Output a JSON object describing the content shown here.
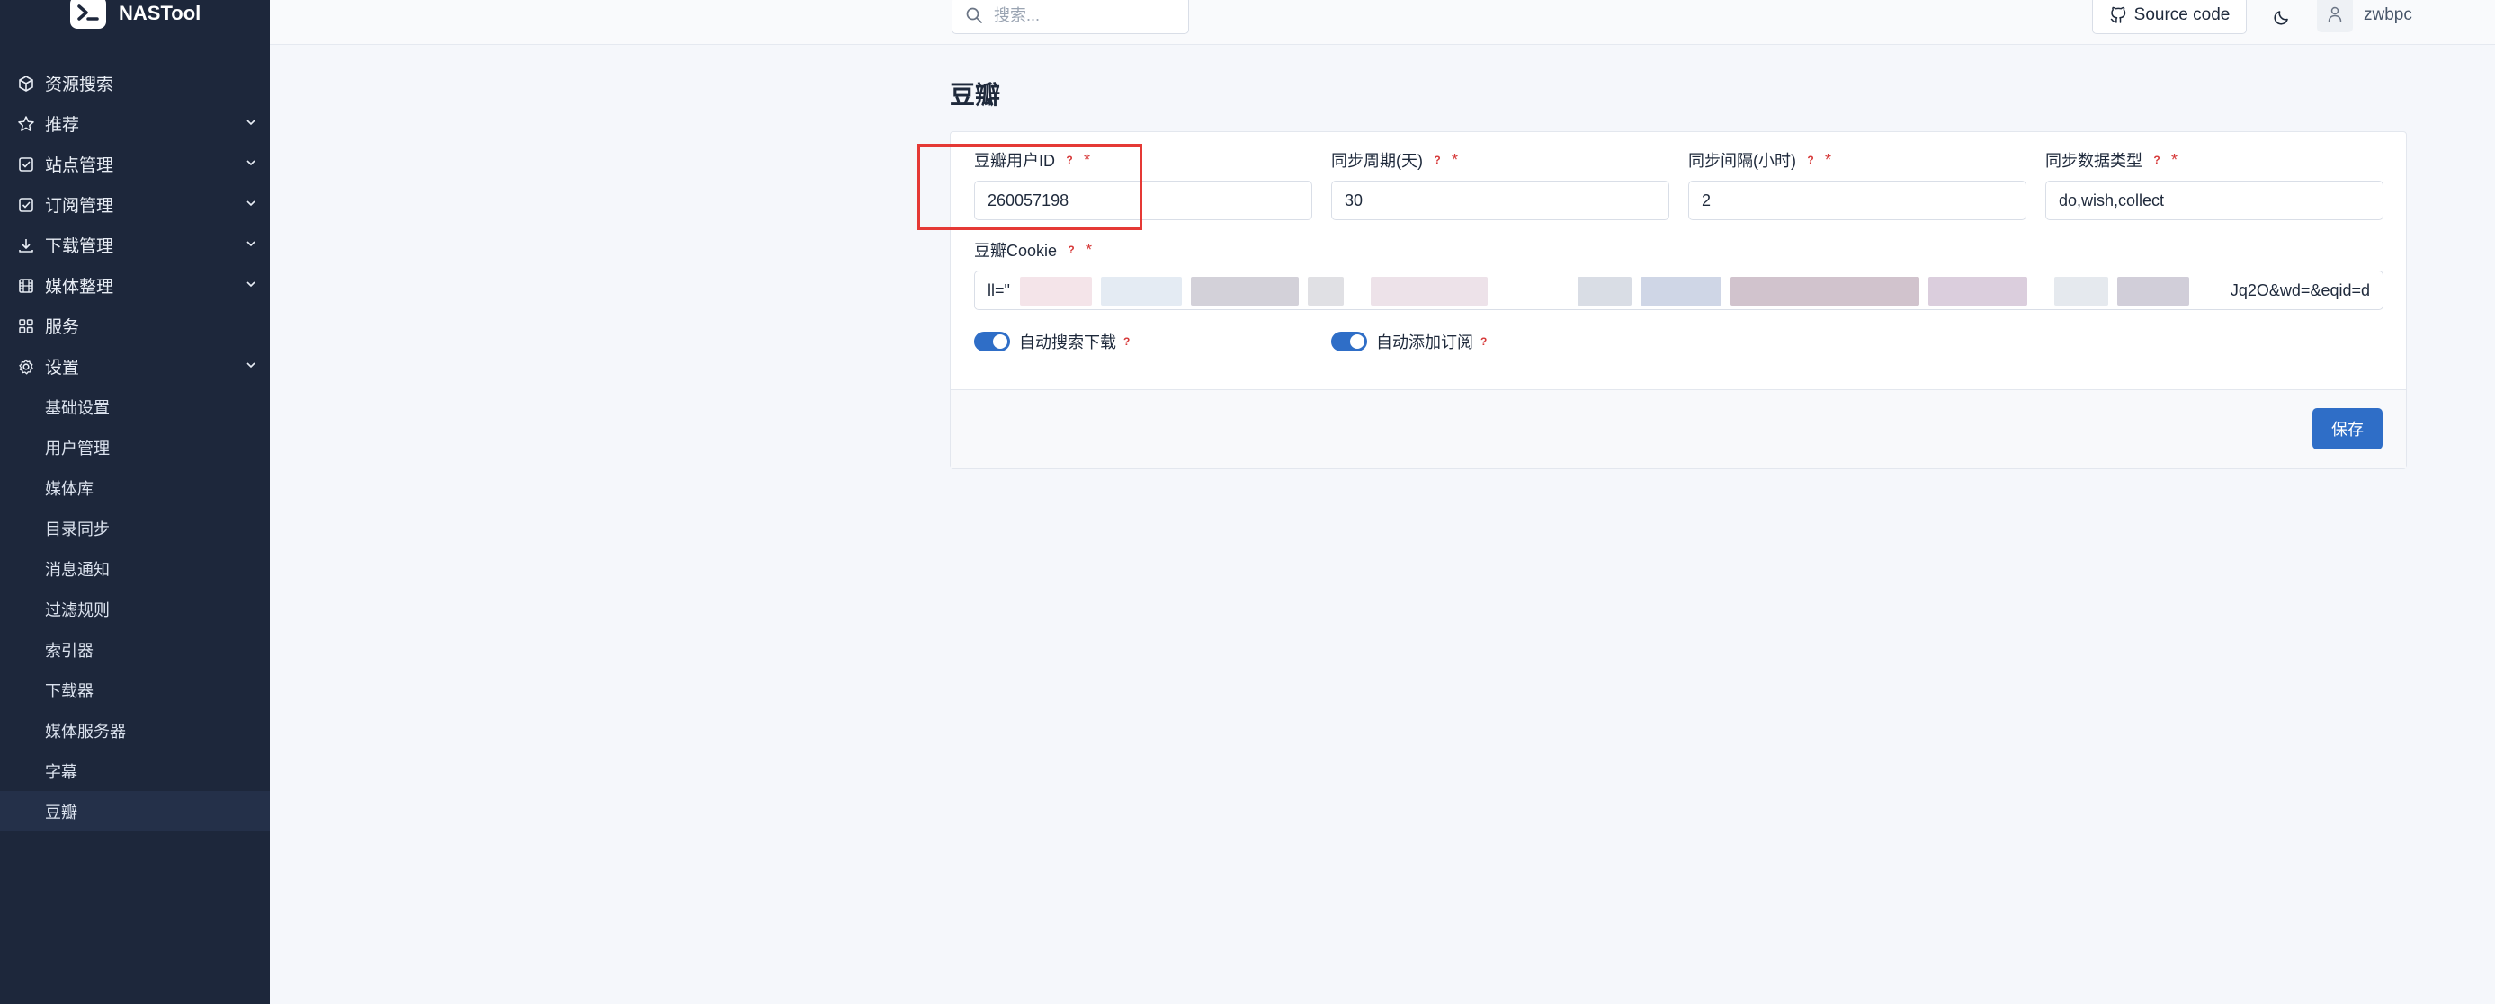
{
  "app": {
    "name": "NASTool"
  },
  "sidebar": {
    "items": [
      {
        "label": "资源搜索",
        "icon": "cube-icon",
        "has_children": false
      },
      {
        "label": "推荐",
        "icon": "star-icon",
        "has_children": true
      },
      {
        "label": "站点管理",
        "icon": "checkbox-icon",
        "has_children": true
      },
      {
        "label": "订阅管理",
        "icon": "checkbox-icon",
        "has_children": true
      },
      {
        "label": "下载管理",
        "icon": "download-icon",
        "has_children": true
      },
      {
        "label": "媒体整理",
        "icon": "film-icon",
        "has_children": true
      },
      {
        "label": "服务",
        "icon": "grid-icon",
        "has_children": false
      },
      {
        "label": "设置",
        "icon": "gear-icon",
        "has_children": true
      }
    ],
    "settings_children": [
      "基础设置",
      "用户管理",
      "媒体库",
      "目录同步",
      "消息通知",
      "过滤规则",
      "索引器",
      "下载器",
      "媒体服务器",
      "字幕",
      "豆瓣"
    ],
    "active_child": "豆瓣"
  },
  "header": {
    "search_placeholder": "搜索...",
    "source_code_label": "Source code",
    "username": "zwbpc"
  },
  "page": {
    "title": "豆瓣",
    "fields": {
      "user_id": {
        "label": "豆瓣用户ID",
        "value": "260057198"
      },
      "sync_period": {
        "label": "同步周期(天)",
        "value": "30"
      },
      "sync_interval": {
        "label": "同步间隔(小时)",
        "value": "2"
      },
      "sync_types": {
        "label": "同步数据类型",
        "value": "do,wish,collect"
      },
      "cookie": {
        "label": "豆瓣Cookie",
        "value_start": "ll=\"",
        "value_end": "Jq2O&wd=&eqid=d"
      }
    },
    "toggles": {
      "auto_search": {
        "label": "自动搜索下载",
        "on": true
      },
      "auto_subscribe": {
        "label": "自动添加订阅",
        "on": true
      }
    },
    "help_mark": "?",
    "required_mark": "*",
    "save_label": "保存"
  },
  "colors": {
    "sidebar_bg": "#1d273b",
    "primary": "#2f6ec7",
    "highlight": "#e53935",
    "required": "#d63939"
  }
}
